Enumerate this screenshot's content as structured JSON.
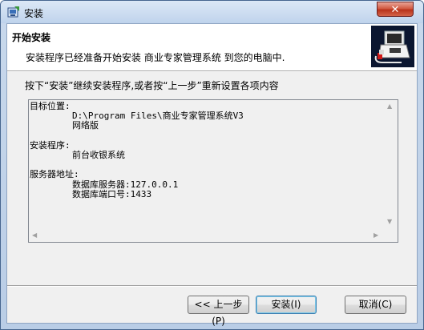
{
  "window": {
    "title": "安装",
    "close_symbol": "✕"
  },
  "header": {
    "title": "开始安装",
    "description": "安装程序已经准备开始安装 商业专家管理系统 到您的电脑中."
  },
  "instruction": "按下“安装”继续安装程序,或者按“上一步”重新设置各项内容",
  "memo": {
    "text": "目标位置:\n        D:\\Program Files\\商业专家管理系统V3\n        网络版\n\n安装程序:\n        前台收银系统\n\n服务器地址:\n        数据库服务器:127.0.0.1\n        数据库端口号:1433"
  },
  "buttons": {
    "back": "<< 上一步(P)",
    "install": "安装(I)",
    "cancel": "取消(C)"
  }
}
